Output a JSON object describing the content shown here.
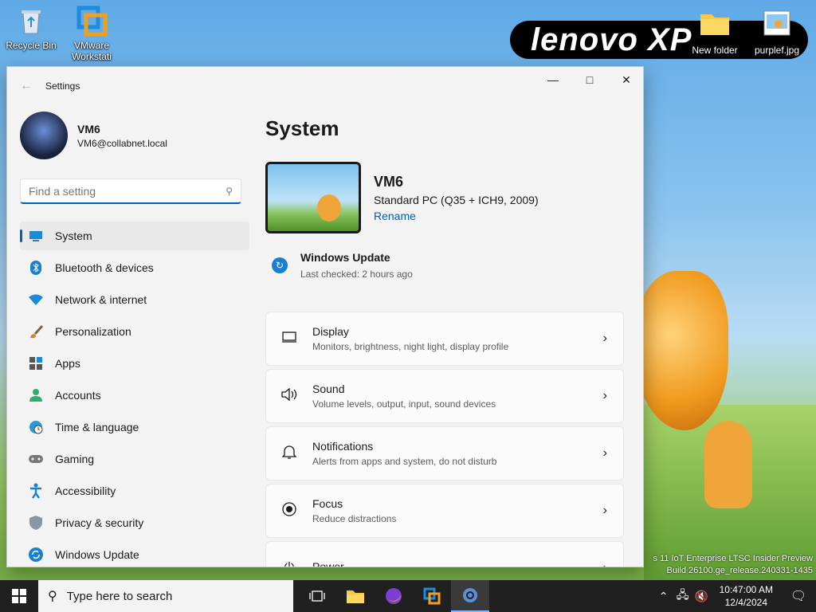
{
  "desktop": {
    "icons": [
      {
        "label": "Recycle Bin"
      },
      {
        "label": "VMware Workstati"
      },
      {
        "label": "New folder"
      },
      {
        "label": "purplef.jpg"
      }
    ],
    "brand": "lenovo XP",
    "watermark": [
      "s 11 IoT Enterprise LTSC Insider Preview",
      "Build 26100.ge_release.240331-1435"
    ]
  },
  "window": {
    "title": "Settings",
    "user": {
      "name": "VM6",
      "email": "VM6@collabnet.local"
    },
    "search": {
      "placeholder": "Find a setting"
    },
    "nav": [
      {
        "label": "System",
        "icon": "monitor-icon"
      },
      {
        "label": "Bluetooth & devices",
        "icon": "bluetooth-icon"
      },
      {
        "label": "Network & internet",
        "icon": "wifi-icon"
      },
      {
        "label": "Personalization",
        "icon": "brush-icon"
      },
      {
        "label": "Apps",
        "icon": "apps-icon"
      },
      {
        "label": "Accounts",
        "icon": "person-icon"
      },
      {
        "label": "Time & language",
        "icon": "globe-clock-icon"
      },
      {
        "label": "Gaming",
        "icon": "gamepad-icon"
      },
      {
        "label": "Accessibility",
        "icon": "accessibility-icon"
      },
      {
        "label": "Privacy & security",
        "icon": "shield-icon"
      },
      {
        "label": "Windows Update",
        "icon": "update-icon"
      }
    ],
    "main": {
      "heading": "System",
      "device": {
        "name": "VM6",
        "model": "Standard PC (Q35 + ICH9, 2009)",
        "rename": "Rename"
      },
      "update": {
        "title": "Windows Update",
        "subtitle": "Last checked: 2 hours ago"
      },
      "cards": [
        {
          "title": "Display",
          "subtitle": "Monitors, brightness, night light, display profile",
          "icon": "display-icon"
        },
        {
          "title": "Sound",
          "subtitle": "Volume levels, output, input, sound devices",
          "icon": "speaker-icon"
        },
        {
          "title": "Notifications",
          "subtitle": "Alerts from apps and system, do not disturb",
          "icon": "bell-icon"
        },
        {
          "title": "Focus",
          "subtitle": "Reduce distractions",
          "icon": "focus-icon"
        },
        {
          "title": "Power",
          "subtitle": "",
          "icon": "power-icon"
        }
      ]
    }
  },
  "taskbar": {
    "search_placeholder": "Type here to search",
    "time": "10:47:00 AM",
    "date": "12/4/2024"
  }
}
